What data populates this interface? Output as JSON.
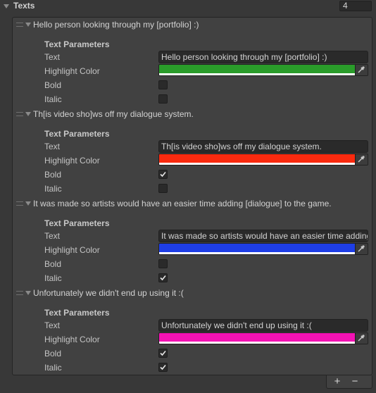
{
  "header": {
    "title": "Texts",
    "count": "4"
  },
  "labels": {
    "section_title": "Text Parameters",
    "text": "Text",
    "highlight_color": "Highlight Color",
    "bold": "Bold",
    "italic": "Italic"
  },
  "elements": [
    {
      "title": "Hello person looking through my [portfolio] :)",
      "text": "Hello person looking through my [portfolio] :)",
      "color": "#2a9c2a",
      "bold": false,
      "italic": false
    },
    {
      "title": "Th[is video sho]ws off my dialogue system.",
      "text": "Th[is video sho]ws off my dialogue system.",
      "color": "#fa2a0f",
      "bold": true,
      "italic": false
    },
    {
      "title": "It was made so artists would have an easier time adding [dialogue] to the game.",
      "text": "It was made so artists would have an easier time adding [dialogue] to the game.",
      "color": "#1e3ee6",
      "bold": false,
      "italic": true
    },
    {
      "title": "Unfortunately we didn't end up using it :(",
      "text": "Unfortunately we didn't end up using it :(",
      "color": "#f412b4",
      "bold": true,
      "italic": true
    }
  ],
  "footer": {
    "add_label": "+",
    "remove_label": "−"
  }
}
